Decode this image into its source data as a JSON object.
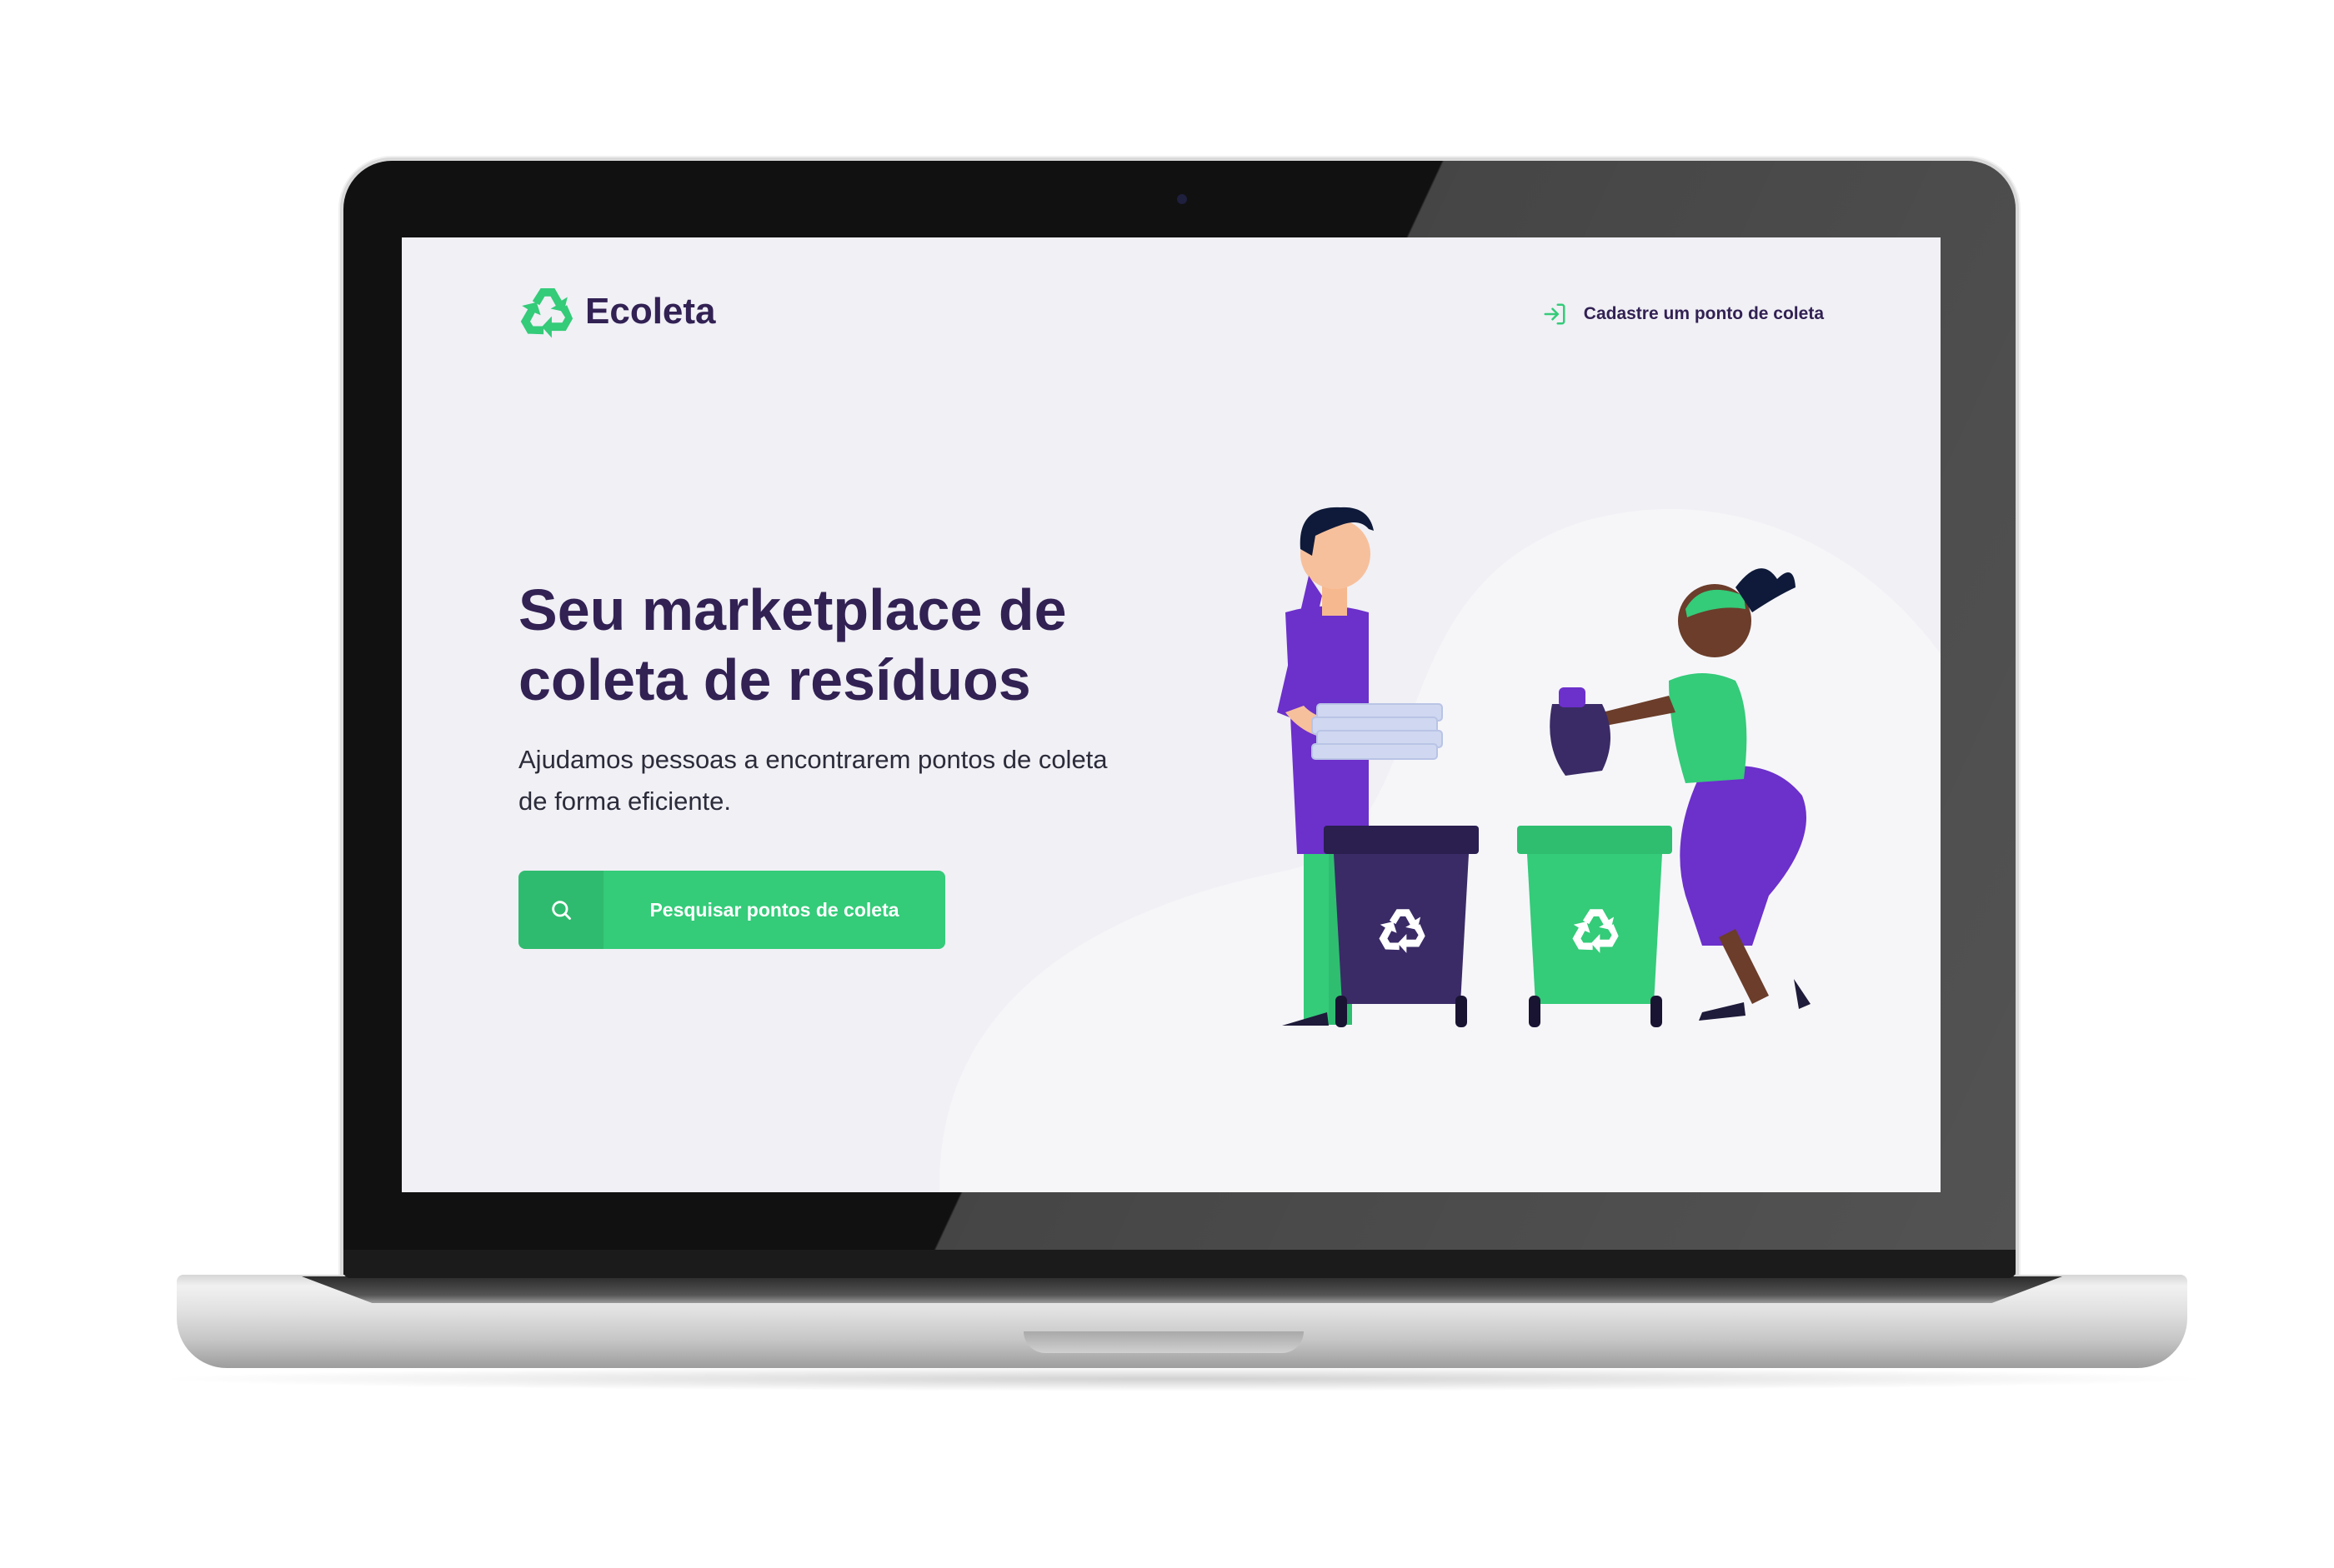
{
  "app": {
    "logo_name": "Ecoleta",
    "colors": {
      "primary": "#34CB79",
      "title": "#322153",
      "background": "#F0F0F5",
      "accent_purple": "#6C30CB"
    }
  },
  "header": {
    "brand": "Ecoleta",
    "brand_icon": "recycle-icon",
    "register_link": {
      "label": "Cadastre um ponto de coleta",
      "icon": "log-in-icon"
    }
  },
  "hero": {
    "title_line1": "Seu marketplace de",
    "title_line2": "coleta de resíduos",
    "description_line1": "Ajudamos pessoas a encontrarem pontos de coleta",
    "description_line2": "de forma eficiente.",
    "cta": {
      "label": "Pesquisar pontos de coleta",
      "icon": "search-icon"
    }
  },
  "illustration": {
    "subject": "recycling-people-illustration",
    "bin_icons": [
      "recycle-icon",
      "recycle-icon"
    ]
  }
}
